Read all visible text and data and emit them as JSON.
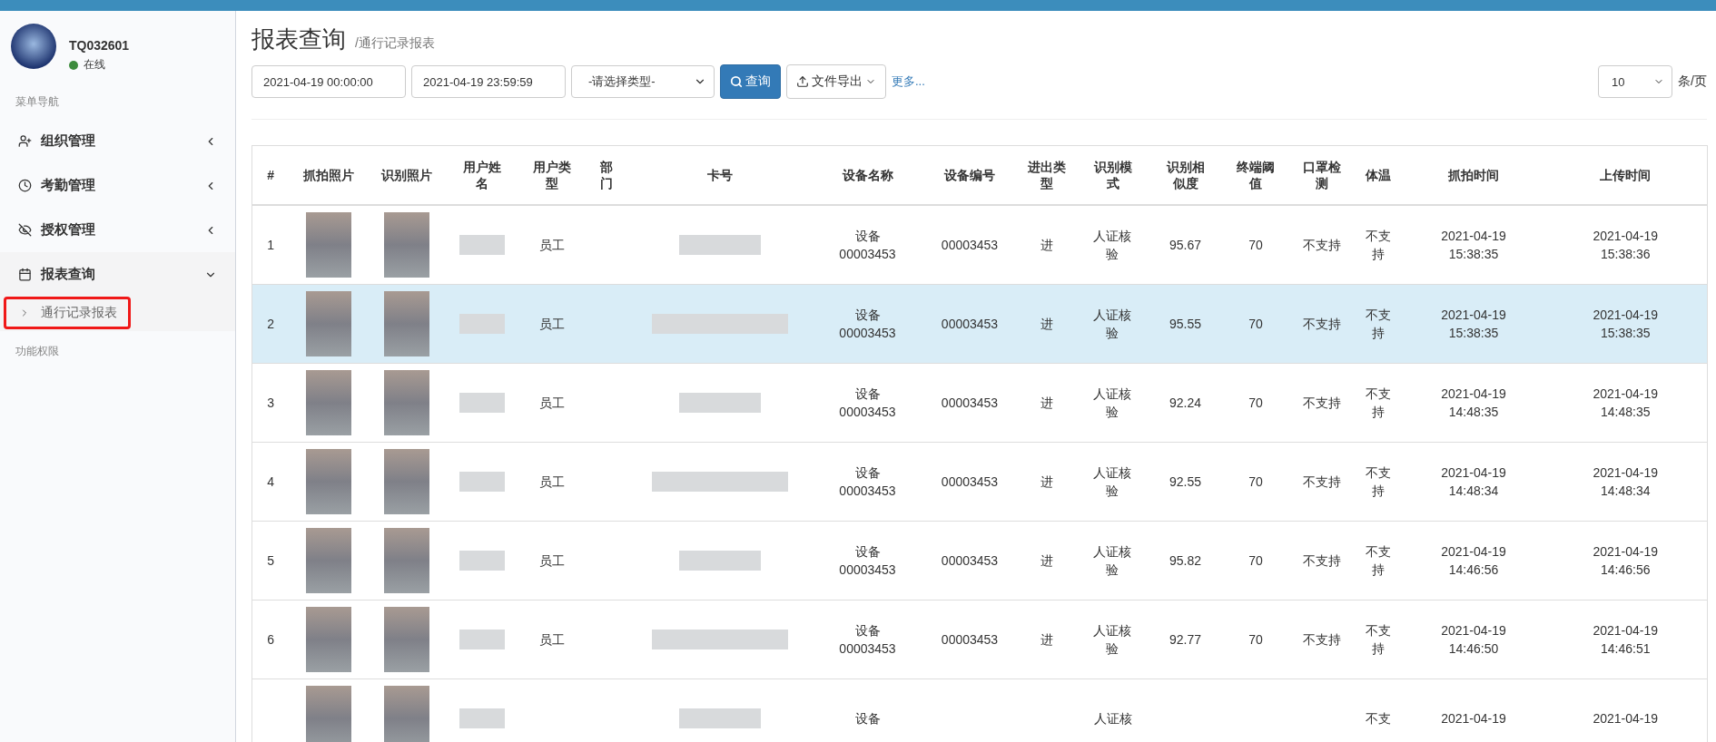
{
  "user": {
    "name": "TQ032601",
    "status": "在线",
    "online": true
  },
  "sidebar": {
    "section_title": "菜单导航",
    "items": [
      {
        "label": "组织管理",
        "expanded": false
      },
      {
        "label": "考勤管理",
        "expanded": false
      },
      {
        "label": "授权管理",
        "expanded": false
      },
      {
        "label": "报表查询",
        "expanded": true,
        "children": [
          {
            "label": "通行记录报表",
            "selected": true
          }
        ]
      }
    ],
    "footer_title": "功能权限"
  },
  "page": {
    "title": "报表查询",
    "breadcrumb": "/通行记录报表"
  },
  "toolbar": {
    "start_time": "2021-04-19 00:00:00",
    "end_time": "2021-04-19 23:59:59",
    "type_select": "-请选择类型-",
    "search_button": "查询",
    "export_button": "文件导出",
    "more_link": "更多...",
    "page_size": "10",
    "page_size_unit": "条/页"
  },
  "table": {
    "columns": [
      "#",
      "抓拍照片",
      "识别照片",
      "用户姓名",
      "用户类型",
      "部门",
      "卡号",
      "设备名称",
      "设备编号",
      "进出类型",
      "识别模式",
      "识别相似度",
      "终端阈值",
      "口罩检测",
      "体温",
      "抓拍时间",
      "上传时间"
    ],
    "rows": [
      {
        "index": "1",
        "selected": false,
        "user_type": "员工",
        "device_name": "设备 00003453",
        "device_no": "00003453",
        "direction": "进",
        "mode": "人证核验",
        "similarity": "95.67",
        "threshold": "70",
        "mask": "不支持",
        "temperature": "不支持",
        "capture_time": "2021-04-19 15:38:35",
        "upload_time": "2021-04-19 15:38:36"
      },
      {
        "index": "2",
        "selected": true,
        "user_type": "员工",
        "device_name": "设备 00003453",
        "device_no": "00003453",
        "direction": "进",
        "mode": "人证核验",
        "similarity": "95.55",
        "threshold": "70",
        "mask": "不支持",
        "temperature": "不支持",
        "capture_time": "2021-04-19 15:38:35",
        "upload_time": "2021-04-19 15:38:35"
      },
      {
        "index": "3",
        "selected": false,
        "user_type": "员工",
        "device_name": "设备 00003453",
        "device_no": "00003453",
        "direction": "进",
        "mode": "人证核验",
        "similarity": "92.24",
        "threshold": "70",
        "mask": "不支持",
        "temperature": "不支持",
        "capture_time": "2021-04-19 14:48:35",
        "upload_time": "2021-04-19 14:48:35"
      },
      {
        "index": "4",
        "selected": false,
        "user_type": "员工",
        "device_name": "设备 00003453",
        "device_no": "00003453",
        "direction": "进",
        "mode": "人证核验",
        "similarity": "92.55",
        "threshold": "70",
        "mask": "不支持",
        "temperature": "不支持",
        "capture_time": "2021-04-19 14:48:34",
        "upload_time": "2021-04-19 14:48:34"
      },
      {
        "index": "5",
        "selected": false,
        "user_type": "员工",
        "device_name": "设备 00003453",
        "device_no": "00003453",
        "direction": "进",
        "mode": "人证核验",
        "similarity": "95.82",
        "threshold": "70",
        "mask": "不支持",
        "temperature": "不支持",
        "capture_time": "2021-04-19 14:46:56",
        "upload_time": "2021-04-19 14:46:56"
      },
      {
        "index": "6",
        "selected": false,
        "user_type": "员工",
        "device_name": "设备 00003453",
        "device_no": "00003453",
        "direction": "进",
        "mode": "人证核验",
        "similarity": "92.77",
        "threshold": "70",
        "mask": "不支持",
        "temperature": "不支持",
        "capture_time": "2021-04-19 14:46:50",
        "upload_time": "2021-04-19 14:46:51"
      },
      {
        "selected": false,
        "device_name": "设备",
        "mode": "人证核",
        "temperature": "不支",
        "capture_time": "2021-04-19",
        "upload_time": "2021-04-19"
      }
    ]
  }
}
